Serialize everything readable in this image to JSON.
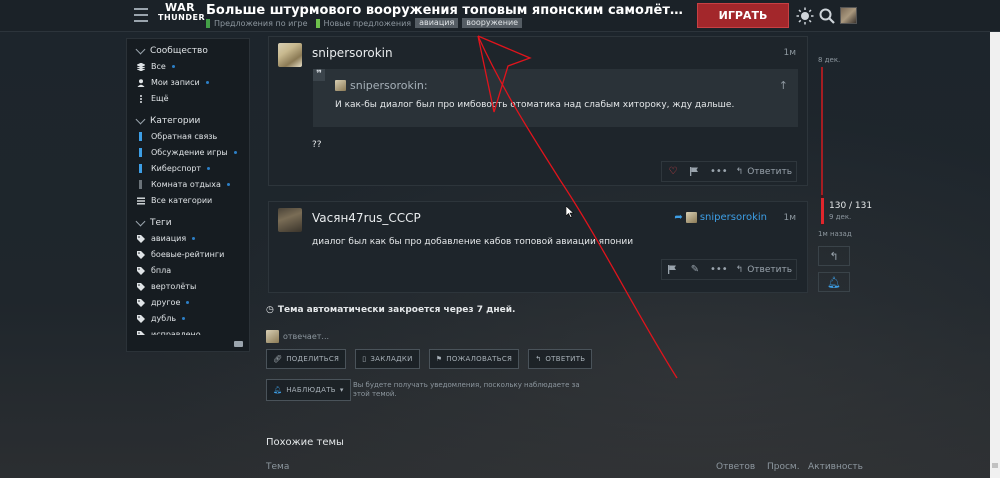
{
  "header": {
    "logo_line1": "WAR",
    "logo_line2": "THUNDER",
    "title": "Больше штурмового вооружения топовым японским самолётам в будущем обновлении",
    "category1": "Предложения по игре",
    "category2": "Новые предложения",
    "tags": [
      "авиация",
      "вооружение"
    ],
    "play_label": "ИГРАТЬ",
    "icons": [
      "menu-icon",
      "theme-icon",
      "search-icon",
      "avatar"
    ]
  },
  "sidebar": {
    "community_title": "Сообщество",
    "community_items": [
      "Все",
      "Мои записи",
      "Ещё"
    ],
    "categories_title": "Категории",
    "category_items": [
      {
        "label": "Обратная связь",
        "color": "#3d9ee5"
      },
      {
        "label": "Обсуждение игры",
        "color": "#3d9ee5"
      },
      {
        "label": "Киберспорт",
        "color": "#3d9ee5"
      },
      {
        "label": "Комната отдыха",
        "color": "#6b7379"
      },
      {
        "label": "Все категории",
        "color": ""
      }
    ],
    "tags_title": "Теги",
    "tag_items": [
      "авиация",
      "боевые-рейтинги",
      "бпла",
      "вертолёты",
      "другое",
      "дубль",
      "исправлено"
    ]
  },
  "posts": [
    {
      "username": "snipersorokin",
      "time": "1м",
      "quote_user": "snipersorokin:",
      "quote_text": "И как-бы диалог был про имбовость отоматика над слабым хитороку, жду дальше.",
      "body": "??",
      "reply_label": "Ответить"
    },
    {
      "username": "Vacян47rus_CCCP",
      "time": "1м",
      "reply_to": "snipersorokin",
      "body": "диалог был как бы про добавление кабов топовой авиации японии",
      "reply_label": "Ответить"
    }
  ],
  "footer": {
    "autoclose": "Тема автоматически закроется через 7 дней.",
    "replying": "отвечает...",
    "share": "ПОДЕЛИТЬСЯ",
    "bookmark": "ЗАКЛАДКИ",
    "flag": "ПОЖАЛОВАТЬСЯ",
    "reply": "ОТВЕТИТЬ",
    "watch": "НАБЛЮДАТЬ",
    "watch_text": "Вы будете получать уведомления, поскольку наблюдаете за этой темой.",
    "similar_title": "Похожие темы",
    "col_topic": "Тема",
    "col_replies": "Ответов",
    "col_views": "Просм.",
    "col_activity": "Активность"
  },
  "timeline": {
    "top_date": "8 дек.",
    "count": "130 / 131",
    "current_date": "9 дек.",
    "ago": "1м назад"
  },
  "colors": {
    "accent": "#a3272b",
    "link": "#3d9ee5",
    "annotation": "#e0141c"
  }
}
